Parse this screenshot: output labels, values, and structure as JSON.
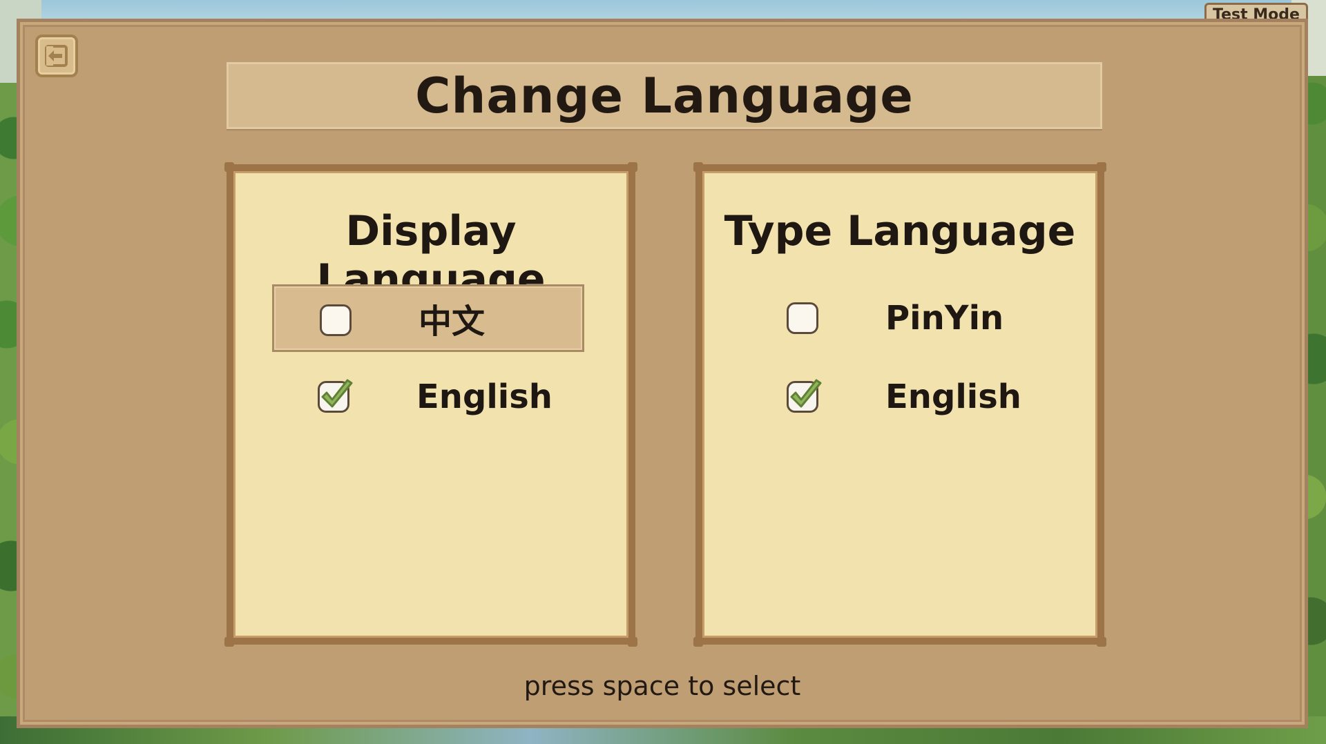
{
  "badge": {
    "test_mode": "Test Mode"
  },
  "dialog": {
    "title": "Change Language",
    "hint": "press space to select",
    "back_icon": "exit-arrow-icon"
  },
  "display_language": {
    "heading": "Display Language",
    "options": [
      {
        "label": "中文",
        "checked": false,
        "highlighted": true
      },
      {
        "label": "English",
        "checked": true,
        "highlighted": false
      }
    ]
  },
  "type_language": {
    "heading": "Type Language",
    "options": [
      {
        "label": "PinYin",
        "checked": false,
        "highlighted": false
      },
      {
        "label": "English",
        "checked": true,
        "highlighted": false
      }
    ]
  },
  "colors": {
    "dialog_bg": "#bf9e74",
    "panel_bg": "#f2e2ae",
    "panel_border": "#9c7448",
    "highlight": "#d8bc90",
    "check": "#8fb45a"
  }
}
